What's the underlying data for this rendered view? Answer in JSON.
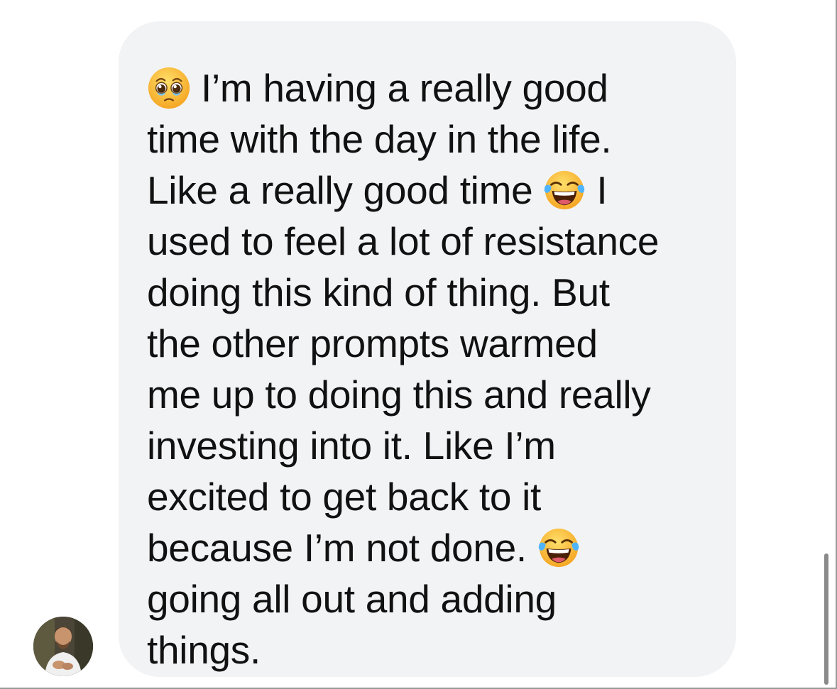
{
  "message": {
    "lines": [
      {
        "before": "",
        "emoji": "pleading-face",
        "after": "I’m having a really good"
      },
      {
        "before": "time with the day in the life.",
        "emoji": "",
        "after": ""
      },
      {
        "before": "Like a really good time",
        "emoji": "tears-of-joy",
        "after": "I"
      },
      {
        "before": "used to feel a lot of resistance",
        "emoji": "",
        "after": ""
      },
      {
        "before": "doing this kind of thing. But",
        "emoji": "",
        "after": ""
      },
      {
        "before": "the other prompts warmed",
        "emoji": "",
        "after": ""
      },
      {
        "before": "me up to doing this and really",
        "emoji": "",
        "after": ""
      },
      {
        "before": "investing into it. Like I’m",
        "emoji": "",
        "after": ""
      },
      {
        "before": "excited to get back to it",
        "emoji": "",
        "after": ""
      },
      {
        "before": "because I’m not done.",
        "emoji": "tears-of-joy",
        "after": ""
      },
      {
        "before": "going all out and adding",
        "emoji": "",
        "after": ""
      },
      {
        "before": "things.",
        "emoji": "",
        "after": ""
      }
    ]
  },
  "colors": {
    "bubble": "#f2f3f5",
    "text": "#111111",
    "background": "#ffffff",
    "emoji_face": "#ffc83d"
  },
  "icons": {
    "avatar": "sender-avatar",
    "emoji_1": "pleading-face-emoji",
    "emoji_2": "tears-of-joy-emoji"
  }
}
